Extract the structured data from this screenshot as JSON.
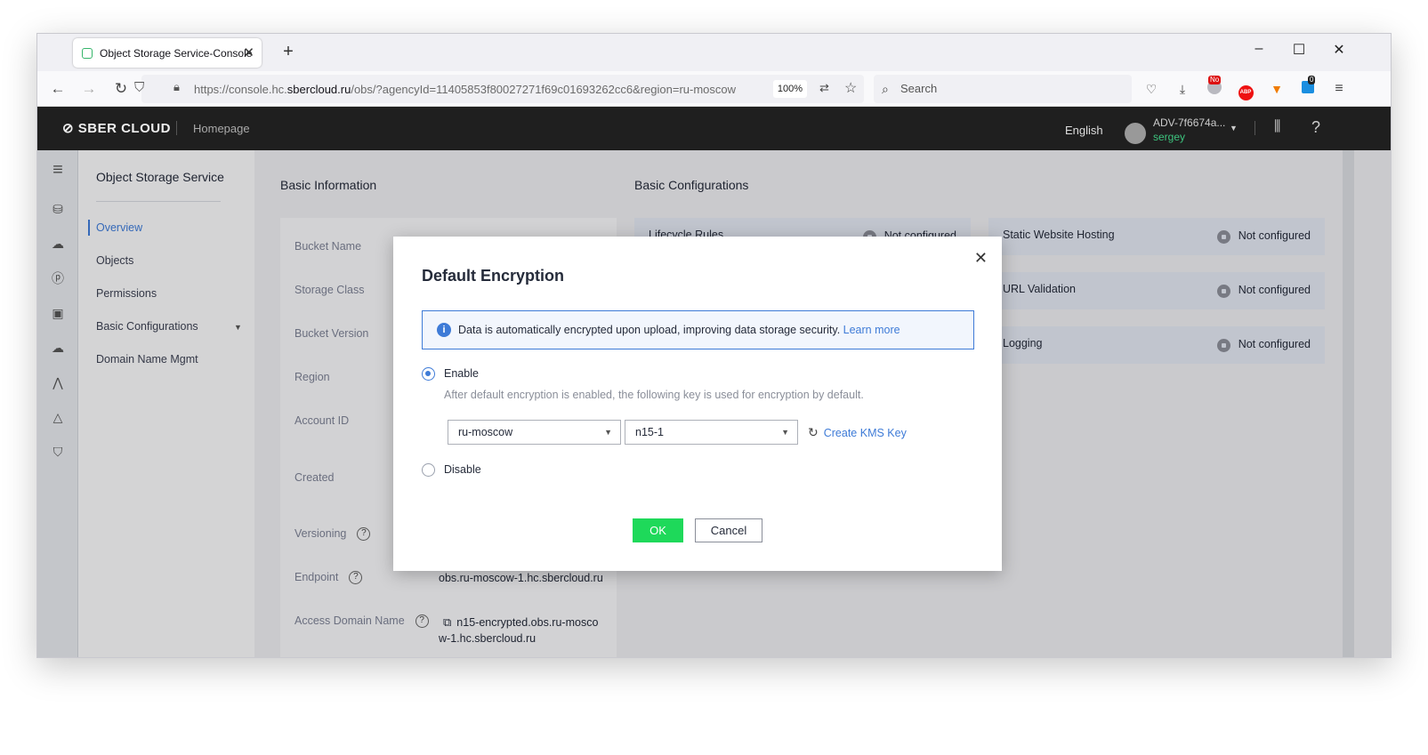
{
  "browser": {
    "tab_title": "Object Storage Service-Console",
    "url_prefix": "https://console.hc.",
    "url_domain": "sbercloud.ru",
    "url_rest": "/obs/?agencyId=11405853f80027271f69c01693262cc6&region=ru-moscow",
    "zoom": "100%",
    "search_placeholder": "Search",
    "ext_badge_no": "No",
    "ext_badge_count": "0"
  },
  "header": {
    "logo": "SBER CLOUD",
    "homepage": "Homepage",
    "language": "English",
    "account": "ADV-7f6674a...",
    "username": "sergey"
  },
  "sidebar": {
    "title": "Object Storage Service",
    "items": [
      {
        "label": "Overview"
      },
      {
        "label": "Objects"
      },
      {
        "label": "Permissions"
      },
      {
        "label": "Basic Configurations"
      },
      {
        "label": "Domain Name Mgmt"
      }
    ]
  },
  "main": {
    "basic_info_title": "Basic Information",
    "basic_config_title": "Basic Configurations",
    "labels": {
      "bucket_name": "Bucket Name",
      "storage_class": "Storage Class",
      "bucket_version": "Bucket Version",
      "region": "Region",
      "account_id": "Account ID",
      "created": "Created",
      "versioning": "Versioning",
      "endpoint": "Endpoint",
      "access_domain": "Access Domain Name"
    },
    "endpoint_value": "obs.ru-moscow-1.hc.sbercloud.ru",
    "access_domain_line1": "n15-encrypted.obs.ru-mosco",
    "access_domain_line2": "w-1.hc.sbercloud.ru",
    "configs": [
      {
        "name": "Lifecycle Rules",
        "status": "Not configured"
      },
      {
        "name": "Static Website Hosting",
        "status": "Not configured"
      },
      {
        "name": "URL Validation",
        "status": "Not configured"
      },
      {
        "name": "Logging",
        "status": "Not configured"
      }
    ]
  },
  "dialog": {
    "title": "Default Encryption",
    "info_text": "Data is automatically encrypted upon upload, improving data storage security.",
    "learn_more": "Learn more",
    "enable_label": "Enable",
    "enable_hint": "After default encryption is enabled, the following key is used for encryption by default.",
    "region_value": "ru-moscow",
    "key_value": "n15-1",
    "create_kms": "Create KMS Key",
    "disable_label": "Disable",
    "ok": "OK",
    "cancel": "Cancel"
  }
}
